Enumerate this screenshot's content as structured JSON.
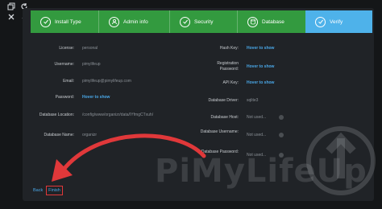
{
  "window_controls": [
    {
      "name": "restore-icon"
    },
    {
      "name": "refresh-icon"
    },
    {
      "name": "close-icon"
    },
    {
      "name": "popout-icon"
    }
  ],
  "stepper": {
    "steps": [
      {
        "label": "Install Type",
        "icon": "check-icon"
      },
      {
        "label": "Admin info",
        "icon": "user-icon"
      },
      {
        "label": "Security",
        "icon": "check-icon"
      },
      {
        "label": "Database",
        "icon": "database-icon"
      },
      {
        "label": "Verify",
        "icon": "check-icon",
        "active": true
      }
    ],
    "colors": {
      "done": "#339a3f",
      "active": "#4eb2ea"
    }
  },
  "left_fields": [
    {
      "label": "License:",
      "value": "personal"
    },
    {
      "label": "Username:",
      "value": "pimylifeup"
    },
    {
      "label": "Email:",
      "value": "pimylifeup@pimylifeup.com"
    },
    {
      "label": "Password:",
      "value": "Hover to show",
      "link": true
    },
    {
      "label": "Database Location:",
      "value": "/config/www/organizr/data/IYfmgCTxuh/"
    },
    {
      "label": "Database Name:",
      "value": "organizr"
    }
  ],
  "right_fields": [
    {
      "label": "Hash Key:",
      "value": "Hover to show",
      "link": true
    },
    {
      "label": "Registration Password:",
      "value": "Hover to show",
      "link": true
    },
    {
      "label": "API Key:",
      "value": "Hover to show",
      "link": true
    },
    {
      "label": "Database Driver:",
      "value": "sqlite3"
    },
    {
      "label": "Database Host:",
      "value": "Not used..."
    },
    {
      "label": "Database Username:",
      "value": "Not used..."
    },
    {
      "label": "Database Password:",
      "value": "Not used..."
    }
  ],
  "actions": {
    "back_label": "Back",
    "finish_label": "Finish"
  },
  "watermark": {
    "text": "PiMyLifeUp"
  }
}
